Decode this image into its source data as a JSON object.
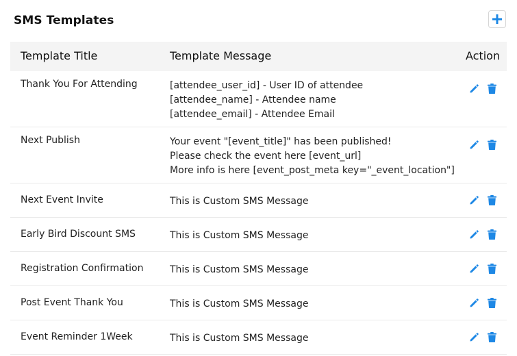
{
  "page": {
    "title": "SMS Templates"
  },
  "colors": {
    "accent": "#1e88e5",
    "header_bg": "#f4f4f4"
  },
  "icons": {
    "add": "plus-icon",
    "edit": "pencil-icon",
    "delete": "trash-icon"
  },
  "table": {
    "headers": {
      "title": "Template Title",
      "message": "Template Message",
      "action": "Action"
    },
    "rows": [
      {
        "title": "Thank You For Attending",
        "message": [
          "[attendee_user_id] - User ID of attendee",
          "[attendee_name] - Attendee name",
          "[attendee_email] - Attendee Email"
        ]
      },
      {
        "title": "Next Publish",
        "message": [
          "Your event \"[event_title]\" has been published!",
          "Please check the event here [event_url]",
          "More info is here [event_post_meta key=\"_event_location\"]"
        ]
      },
      {
        "title": "Next Event Invite",
        "message": [
          "This is Custom SMS Message"
        ]
      },
      {
        "title": "Early Bird Discount SMS",
        "message": [
          "This is Custom SMS Message"
        ]
      },
      {
        "title": "Registration Confirmation",
        "message": [
          "This is Custom SMS Message"
        ]
      },
      {
        "title": "Post Event Thank You",
        "message": [
          "This is Custom SMS Message"
        ]
      },
      {
        "title": "Event Reminder 1Week",
        "message": [
          "This is Custom SMS Message"
        ]
      }
    ]
  }
}
